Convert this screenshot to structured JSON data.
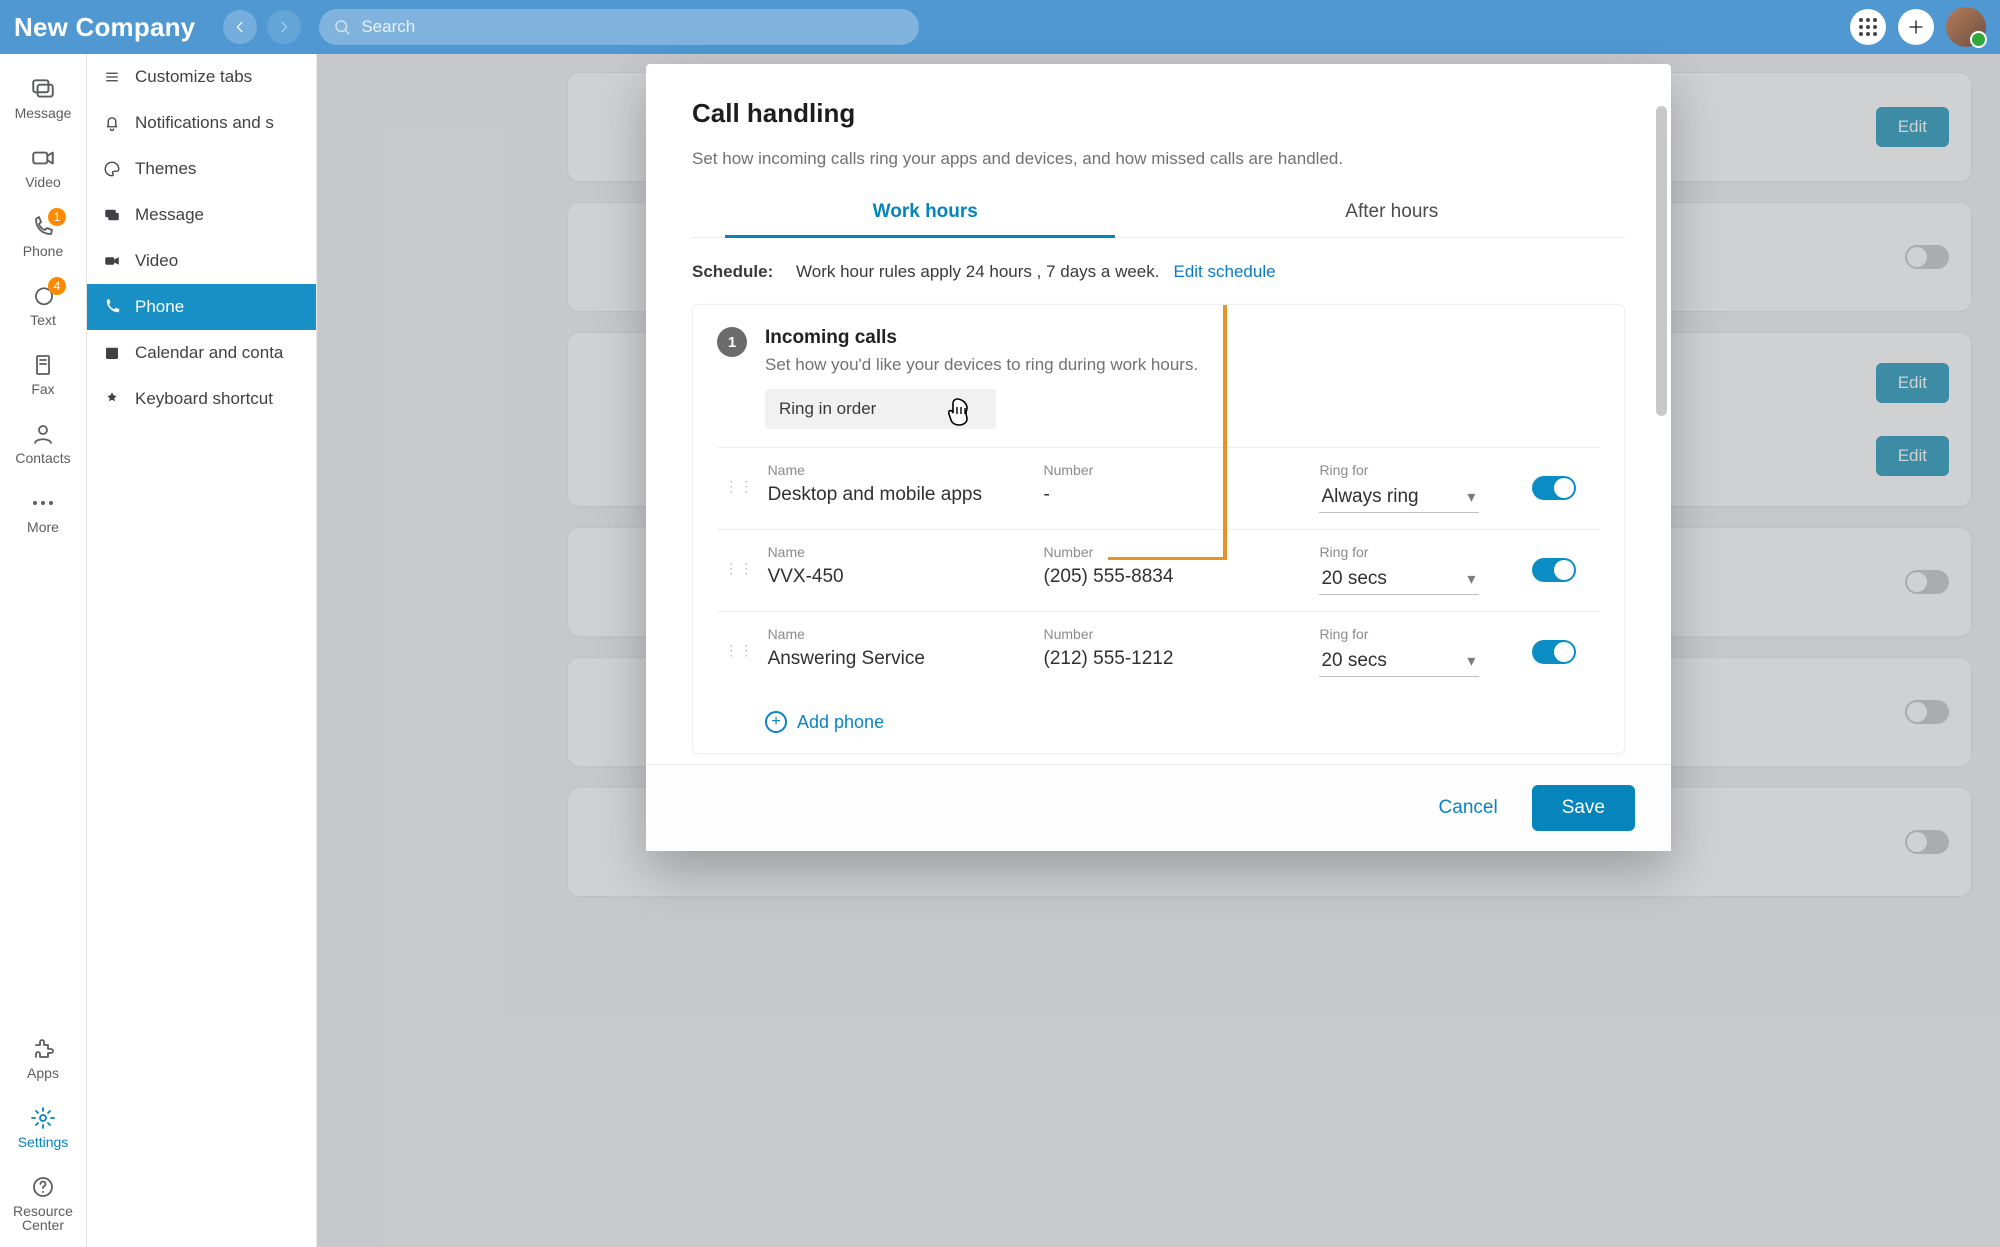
{
  "header": {
    "brand": "New Company",
    "search_placeholder": "Search"
  },
  "rail": {
    "message": {
      "label": "Message"
    },
    "video": {
      "label": "Video"
    },
    "phone": {
      "label": "Phone",
      "badge": "1"
    },
    "text": {
      "label": "Text",
      "badge": "4"
    },
    "fax": {
      "label": "Fax"
    },
    "contacts": {
      "label": "Contacts"
    },
    "more": {
      "label": "More"
    },
    "apps": {
      "label": "Apps"
    },
    "settings": {
      "label": "Settings"
    },
    "resource": {
      "label_line1": "Resource",
      "label_line2": "Center"
    }
  },
  "settings_nav": {
    "customize": "Customize tabs",
    "notifications": "Notifications and s",
    "themes": "Themes",
    "message": "Message",
    "video": "Video",
    "phone": "Phone",
    "calendar": "Calendar and conta",
    "keyboard": "Keyboard shortcut"
  },
  "background_cards": {
    "edit_label": "Edit"
  },
  "modal": {
    "title": "Call handling",
    "subtitle": "Set how incoming calls ring your apps and devices, and how missed calls are handled.",
    "tabs": {
      "work": "Work hours",
      "after": "After hours"
    },
    "schedule_label": "Schedule:",
    "schedule_text": "Work hour rules apply 24 hours , 7 days a week.",
    "schedule_link": "Edit schedule",
    "section1": {
      "step": "1",
      "title": "Incoming calls",
      "subtitle": "Set how you'd like your devices to ring during work hours.",
      "ring_mode": "Ring in order",
      "cols": {
        "name": "Name",
        "number": "Number",
        "ringfor": "Ring for"
      },
      "rows": [
        {
          "name": "Desktop and mobile apps",
          "number": "-",
          "ringfor": "Always ring",
          "on": true
        },
        {
          "name": "VVX-450",
          "number": "(205) 555-8834",
          "ringfor": "20 secs",
          "on": true
        },
        {
          "name": "Answering Service",
          "number": "(212) 555-1212",
          "ringfor": "20 secs",
          "on": true
        }
      ],
      "add_phone": "Add phone"
    },
    "footer": {
      "cancel": "Cancel",
      "save": "Save"
    }
  }
}
